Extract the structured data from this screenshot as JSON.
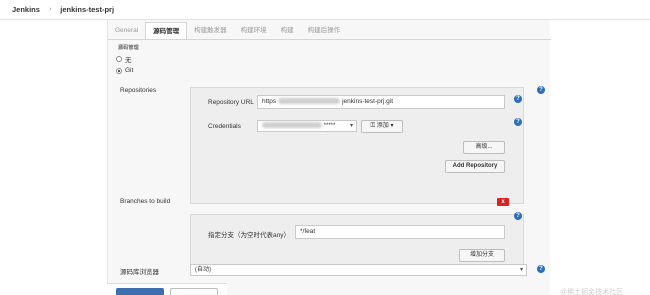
{
  "breadcrumb": {
    "root": "Jenkins",
    "separator": "›",
    "project": "jenkins-test-prj"
  },
  "tabs": [
    {
      "label": "General",
      "active": false
    },
    {
      "label": "源码管理",
      "active": true
    },
    {
      "label": "构建触发器",
      "active": false
    },
    {
      "label": "构建环境",
      "active": false
    },
    {
      "label": "构建",
      "active": false
    },
    {
      "label": "构建后操作",
      "active": false
    }
  ],
  "scm": {
    "section_label_cut": "源码管理",
    "option_none": "无",
    "option_git": "Git",
    "selected": "Git"
  },
  "repositories": {
    "label": "Repositories",
    "url_label": "Repository URL",
    "url_prefix": "https",
    "url_suffix": "jenkins-test-prj.git",
    "credentials_label": "Credentials",
    "credentials_masked": "*****",
    "add_button": "添加",
    "advanced_button": "高级...",
    "add_repository_button": "Add Repository"
  },
  "branches": {
    "label": "Branches to build",
    "specifier_label": "指定分支（为空时代表any）",
    "specifier_value": "*/feat",
    "delete_label": "x",
    "add_branch_button": "增加分支"
  },
  "browser": {
    "label": "源码库浏览器",
    "value": "(自动)"
  },
  "help_symbol": "?",
  "watermark": "@稀土掘金技术社区",
  "colors": {
    "primary_button": "#3b6fb0",
    "help_icon": "#2c6fb7",
    "delete_button": "#d92222"
  }
}
